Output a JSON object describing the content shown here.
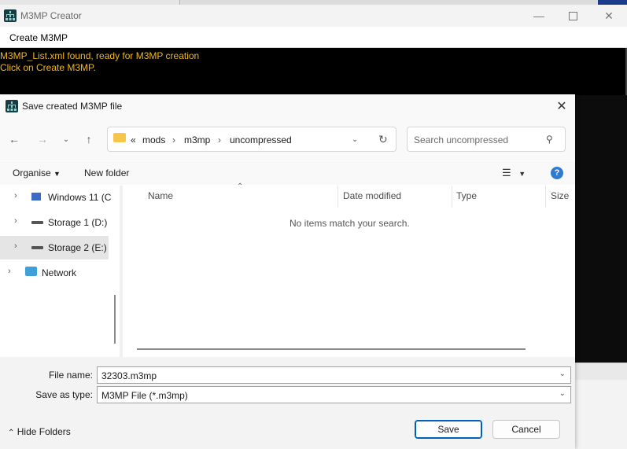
{
  "app": {
    "title": "M3MP Creator",
    "menu": {
      "create_label": "Create M3MP"
    },
    "console_lines": [
      "M3MP_List.xml found, ready for M3MP creation",
      "Click on Create M3MP."
    ]
  },
  "dialog": {
    "title": "Save created M3MP file",
    "address": {
      "overflow": "«",
      "crumbs": [
        "mods",
        "m3mp",
        "uncompressed"
      ]
    },
    "search": {
      "placeholder": "Search uncompressed"
    },
    "commands": {
      "organise_label": "Organise",
      "new_folder_label": "New folder"
    },
    "nav_items": [
      {
        "label": "Windows 11 (C",
        "icon": "windows-drive-icon"
      },
      {
        "label": "Storage 1 (D:)",
        "icon": "drive-icon"
      },
      {
        "label": "Storage 2 (E:)",
        "icon": "drive-icon",
        "selected": true
      },
      {
        "label": "Network",
        "icon": "network-icon"
      }
    ],
    "columns": [
      "Name",
      "Date modified",
      "Type",
      "Size"
    ],
    "empty_message": "No items match your search.",
    "file_name_label": "File name:",
    "file_name_value": "32303.m3mp",
    "save_type_label": "Save as type:",
    "save_type_value": "M3MP File (*.m3mp)",
    "hide_folders_label": "Hide Folders",
    "save_label": "Save",
    "cancel_label": "Cancel"
  },
  "colors": {
    "console_text": "#f0b81e",
    "console_bg": "#000000",
    "accent": "#005fb8"
  }
}
